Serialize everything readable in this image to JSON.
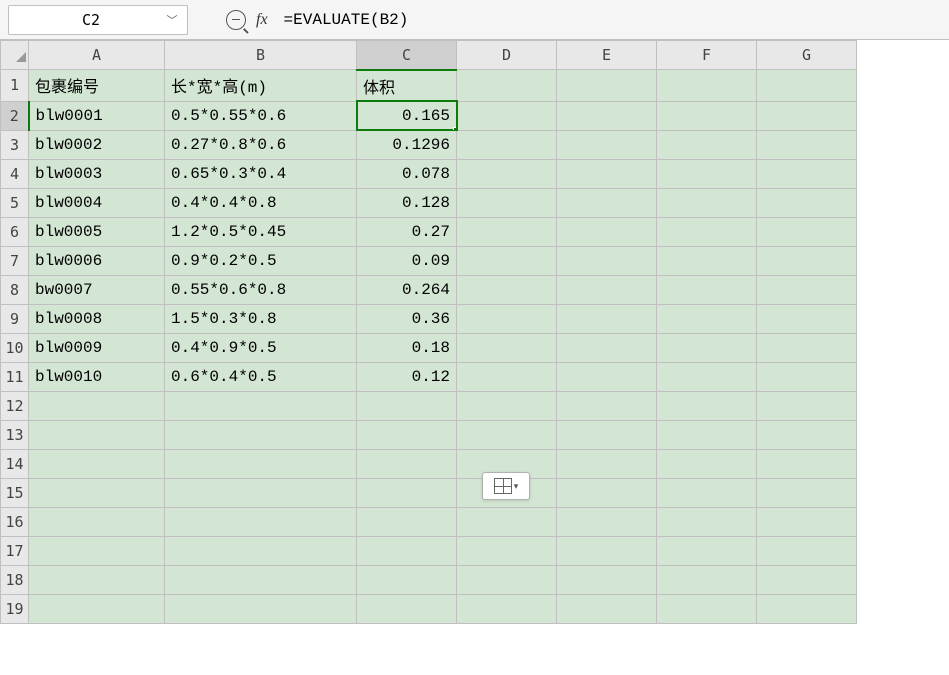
{
  "name_box": "C2",
  "fx_label": "fx",
  "formula": "=EVALUATE(B2)",
  "columns": [
    "A",
    "B",
    "C",
    "D",
    "E",
    "F",
    "G"
  ],
  "headers": {
    "A": "包裹编号",
    "B": "长*宽*高(m)",
    "C": "体积"
  },
  "rows": [
    {
      "n": 1,
      "A": "包裹编号",
      "B": "长*宽*高(m)",
      "C": "体积"
    },
    {
      "n": 2,
      "A": "blw0001",
      "B": "0.5*0.55*0.6",
      "C": "0.165"
    },
    {
      "n": 3,
      "A": "blw0002",
      "B": "0.27*0.8*0.6",
      "C": "0.1296"
    },
    {
      "n": 4,
      "A": "blw0003",
      "B": "0.65*0.3*0.4",
      "C": "0.078"
    },
    {
      "n": 5,
      "A": "blw0004",
      "B": "0.4*0.4*0.8",
      "C": "0.128"
    },
    {
      "n": 6,
      "A": "blw0005",
      "B": "1.2*0.5*0.45",
      "C": "0.27"
    },
    {
      "n": 7,
      "A": "blw0006",
      "B": "0.9*0.2*0.5",
      "C": "0.09"
    },
    {
      "n": 8,
      "A": "bw0007",
      "B": "0.55*0.6*0.8",
      "C": "0.264"
    },
    {
      "n": 9,
      "A": "blw0008",
      "B": "1.5*0.3*0.8",
      "C": "0.36"
    },
    {
      "n": 10,
      "A": "blw0009",
      "B": "0.4*0.9*0.5",
      "C": "0.18"
    },
    {
      "n": 11,
      "A": "blw0010",
      "B": "0.6*0.4*0.5",
      "C": "0.12"
    },
    {
      "n": 12
    },
    {
      "n": 13
    },
    {
      "n": 14
    },
    {
      "n": 15
    },
    {
      "n": 16
    },
    {
      "n": 17
    },
    {
      "n": 18
    },
    {
      "n": 19
    }
  ],
  "active_cell": {
    "row": 2,
    "col": "C"
  }
}
